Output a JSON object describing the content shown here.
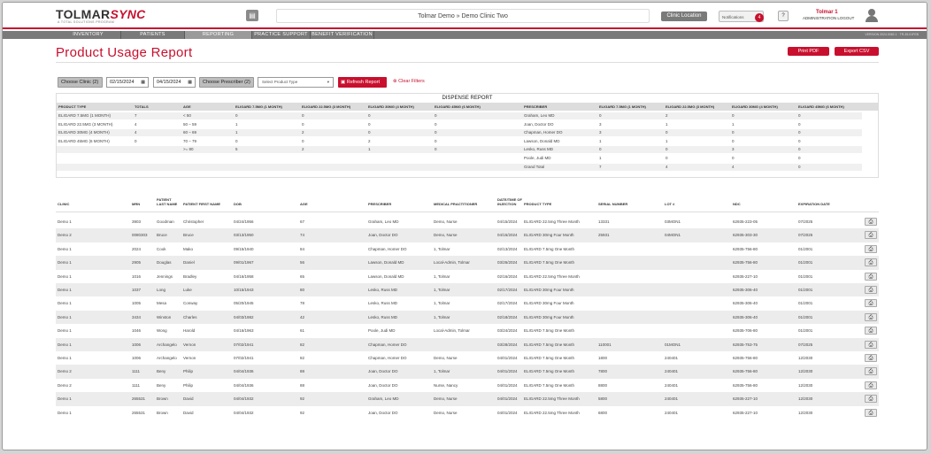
{
  "header": {
    "logo_main": "TOLMAR",
    "logo_sync": "SYNC",
    "logo_tagline": "A TOTAL SOLUTIONS PROGRAM",
    "breadcrumb": "Tolmar Demo  »  Demo Clinic Two",
    "clinic_location_label": "Clinic Location",
    "notifications_label": "Notifications",
    "notifications_count": "4",
    "help_label": "?",
    "user_name": "Tolmar 1",
    "user_role": "ADMINISTRATION  LOGOUT"
  },
  "nav": {
    "items": [
      "INVENTORY",
      "PATIENTS",
      "REPORTING",
      "PRACTICE SUPPORT",
      "BENEFIT VERIFICATION"
    ],
    "active": "REPORTING",
    "version": "VERSION 2024.0062.1 · TR-35.01FEB"
  },
  "page": {
    "title": "Product Usage Report",
    "print_pdf": "Print PDF",
    "export_csv": "Export CSV"
  },
  "filters": {
    "choose_clinic": "Choose Clinic (2)",
    "date_from": "02/15/2024",
    "date_to": "04/15/2024",
    "choose_prescriber": "Choose Prescriber (2)",
    "product_type_placeholder": "Select Product Type",
    "refresh": "Refresh Report",
    "clear": "Clear Filters"
  },
  "dispense": {
    "title": "DISPENSE REPORT",
    "left_headers": [
      "PRODUCT TYPE",
      "TOTALS",
      "AGE",
      "ELIGARD 7.5MG (1 MONTH)",
      "ELIGARD 22.5MG (3 MONTH)",
      "ELIGARD 30MG (4 MONTH)",
      "ELIGARD 45MG (6 MONTH)"
    ],
    "products": [
      {
        "name": "ELIGARD 7.5MG (1 MONTH)",
        "total": "7"
      },
      {
        "name": "ELIGARD 22.5MG (3 MONTH)",
        "total": "4"
      },
      {
        "name": "ELIGARD 30MG (4 MONTH)",
        "total": "4"
      },
      {
        "name": "ELIGARD 45MG (6 MONTH)",
        "total": "0"
      }
    ],
    "ages": [
      {
        "age": "< 50",
        "v": [
          "0",
          "0",
          "0",
          "0"
        ]
      },
      {
        "age": "50 – 59",
        "v": [
          "1",
          "0",
          "0",
          "0"
        ]
      },
      {
        "age": "60 – 69",
        "v": [
          "1",
          "2",
          "0",
          "0"
        ]
      },
      {
        "age": "70 – 79",
        "v": [
          "0",
          "0",
          "2",
          "0"
        ]
      },
      {
        "age": ">= 80",
        "v": [
          "5",
          "2",
          "1",
          "0"
        ]
      }
    ],
    "right_headers": [
      "PRESCRIBER",
      "ELIGARD 7.5MG (1 MONTH)",
      "ELIGARD 22.5MG (3 MONTH)",
      "ELIGARD 30MG (4 MONTH)",
      "ELIGARD 45MG (6 MONTH)"
    ],
    "prescribers": [
      {
        "name": "Graham, Leo MD",
        "v": [
          "0",
          "2",
          "0",
          "0"
        ]
      },
      {
        "name": "Joan, Doctor DO",
        "v": [
          "3",
          "1",
          "1",
          "0"
        ]
      },
      {
        "name": "Chapman, Homer DO",
        "v": [
          "3",
          "0",
          "0",
          "0"
        ]
      },
      {
        "name": "Lawson, Donald MD",
        "v": [
          "1",
          "1",
          "0",
          "0"
        ]
      },
      {
        "name": "Lesko, Russ MD",
        "v": [
          "0",
          "0",
          "3",
          "0"
        ]
      },
      {
        "name": "Poole, Judi MD",
        "v": [
          "1",
          "0",
          "0",
          "0"
        ]
      },
      {
        "name": "Grand Total",
        "v": [
          "7",
          "4",
          "4",
          "0"
        ]
      }
    ]
  },
  "table": {
    "headers": [
      "CLINIC",
      "MRN",
      "PATIENT LAST NAME",
      "PATIENT FIRST NAME",
      "DOB",
      "AGE",
      "PRESCRIBER",
      "MEDICAL PRACTITIONER",
      "DATE/TIME OF INJECTION",
      "PRODUCT TYPE",
      "SERIAL NUMBER",
      "LOT #",
      "NDC",
      "EXPIRATION DATE"
    ],
    "rows": [
      [
        "Demo 1",
        "3903",
        "Goodman",
        "Christopher",
        "04/24/1956",
        "67",
        "Graham, Leo MD",
        "Demo, Nurse",
        "04/15/2024",
        "ELIGARD 22.5mg Three Month",
        "13331",
        "03MON1",
        "62935-223-05",
        "07/2025"
      ],
      [
        "Demo 2",
        "0080303",
        "Bruce",
        "Bruce",
        "03/13/1950",
        "74",
        "Joan, Doctor DO",
        "Demo, Nurse",
        "04/15/2024",
        "ELIGARD 30mg Four Month",
        "25931",
        "04MON1",
        "62935-303-30",
        "07/2025"
      ],
      [
        "Demo 1",
        "2024",
        "Cook",
        "Mako",
        "09/15/1940",
        "84",
        "Chapman, Homer DO",
        "1, Tolmar",
        "02/13/2024",
        "ELIGARD 7.5mg One Month",
        "",
        "",
        "62935-756-80",
        "01/2001"
      ],
      [
        "Demo 1",
        "2905",
        "Douglas",
        "Daniel",
        "09/01/1967",
        "56",
        "Lawson, Donald MD",
        "Local-Admin, Tolmar",
        "03/26/2024",
        "ELIGARD 7.5mg One Month",
        "",
        "",
        "62935-756-80",
        "01/2001"
      ],
      [
        "Demo 1",
        "1016",
        "Jennings",
        "Bradley",
        "04/16/1958",
        "65",
        "Lawson, Donald MD",
        "1, Tolmar",
        "02/16/2024",
        "ELIGARD 22.5mg Three Month",
        "",
        "",
        "62935-227-10",
        "01/2001"
      ],
      [
        "Demo 1",
        "1037",
        "Long",
        "Luke",
        "10/15/1943",
        "80",
        "Lesko, Russ MD",
        "1, Tolmar",
        "02/17/2024",
        "ELIGARD 30mg Four Month",
        "",
        "",
        "62935-306-40",
        "01/2001"
      ],
      [
        "Demo 1",
        "1005",
        "Mesa",
        "Conway",
        "05/20/1945",
        "78",
        "Lesko, Russ MD",
        "1, Tolmar",
        "02/17/2024",
        "ELIGARD 30mg Four Month",
        "",
        "",
        "62935-306-40",
        "01/2001"
      ],
      [
        "Demo 1",
        "3434",
        "Winston",
        "Charles",
        "04/03/1982",
        "42",
        "Lesko, Russ MD",
        "1, Tolmar",
        "02/18/2024",
        "ELIGARD 30mg Four Month",
        "",
        "",
        "62935-306-40",
        "01/2001"
      ],
      [
        "Demo 1",
        "1046",
        "Wong",
        "Harold",
        "04/16/1963",
        "61",
        "Poole, Judi MD",
        "Local-Admin, Tolmar",
        "03/24/2024",
        "ELIGARD 7.5mg One Month",
        "",
        "",
        "62935-706-80",
        "01/2001"
      ],
      [
        "Demo 1",
        "1006",
        "Archangelo",
        "Vernon",
        "07/02/1941",
        "82",
        "Chapman, Homer DO",
        "",
        "03/28/2024",
        "ELIGARD 7.5mg One Month",
        "110001",
        "01MON1",
        "62935-753-75",
        "07/2025"
      ],
      [
        "Demo 1",
        "1006",
        "Archangelo",
        "Vernon",
        "07/02/1941",
        "82",
        "Chapman, Homer DO",
        "Demo, Nurse",
        "04/01/2024",
        "ELIGARD 7.5mg One Month",
        "1800",
        "240401",
        "62935-756-80",
        "12/2030"
      ],
      [
        "Demo 2",
        "1111",
        "Beny",
        "Philip",
        "04/04/1936",
        "88",
        "Joan, Doctor DO",
        "1, Tolmar",
        "04/01/2024",
        "ELIGARD 7.5mg One Month",
        "7800",
        "240401",
        "62935-756-80",
        "12/2030"
      ],
      [
        "Demo 2",
        "1111",
        "Beny",
        "Philip",
        "04/04/1936",
        "88",
        "Joan, Doctor DO",
        "Nurse, Nancy",
        "04/01/2024",
        "ELIGARD 7.5mg One Month",
        "8800",
        "240401",
        "62935-756-80",
        "12/2030"
      ],
      [
        "Demo 1",
        "265531",
        "Brown",
        "David",
        "04/04/1932",
        "92",
        "Graham, Leo MD",
        "Demo, Nurse",
        "04/01/2024",
        "ELIGARD 22.5mg Three Month",
        "5800",
        "240401",
        "62935-227-10",
        "12/2030"
      ],
      [
        "Demo 1",
        "265531",
        "Brown",
        "David",
        "04/04/1932",
        "92",
        "Joan, Doctor DO",
        "Demo, Nurse",
        "04/01/2024",
        "ELIGARD 22.5mg Three Month",
        "6800",
        "240401",
        "62935-227-10",
        "12/2030"
      ]
    ]
  },
  "colors": {
    "brand_red": "#c8102e",
    "nav_gray": "#7a7a7a"
  },
  "icons": [
    "folder-icon",
    "calendar-icon",
    "refresh-icon",
    "clear-icon",
    "printer-icon",
    "avatar-icon"
  ]
}
